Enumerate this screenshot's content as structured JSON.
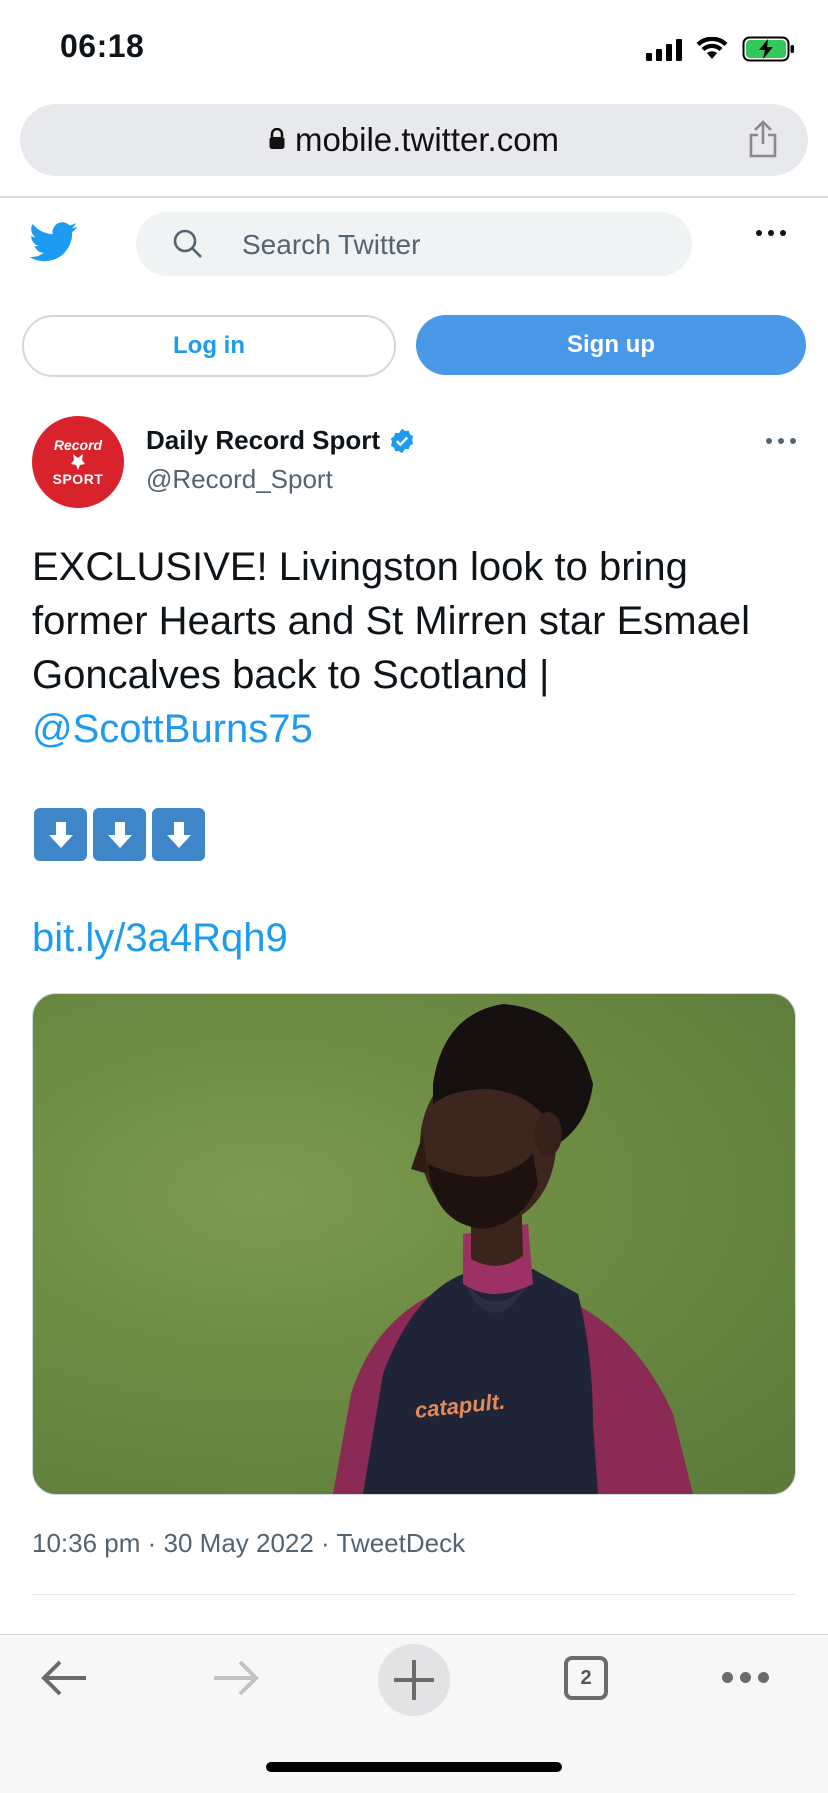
{
  "status_bar": {
    "time": "06:18"
  },
  "browser": {
    "url": "mobile.twitter.com",
    "tab_count": "2"
  },
  "twitter_header": {
    "search_placeholder": "Search Twitter",
    "login_label": "Log in",
    "signup_label": "Sign up"
  },
  "tweet": {
    "avatar_text_top": "Record",
    "avatar_text_bottom": "SPORT",
    "display_name": "Daily Record Sport",
    "handle": "@Record_Sport",
    "text": "EXCLUSIVE! Livingston look to bring former Hearts and St Mirren star Esmael Goncalves back to Scotland | ",
    "mention": "@ScottBurns75",
    "link": "bit.ly/3a4Rqh9",
    "image_shirt_text": "catapult.",
    "meta": "10:36 pm · 30 May 2022 · TweetDeck"
  },
  "icons": {
    "twitter_logo": "bird-icon",
    "verified": "verified-badge-icon",
    "arrows": [
      "down-arrow-icon",
      "down-arrow-icon",
      "down-arrow-icon"
    ]
  },
  "colors": {
    "twitter_blue": "#1d9bf0",
    "signup_bg": "#4a99e9",
    "avatar_red": "#d8232c"
  }
}
